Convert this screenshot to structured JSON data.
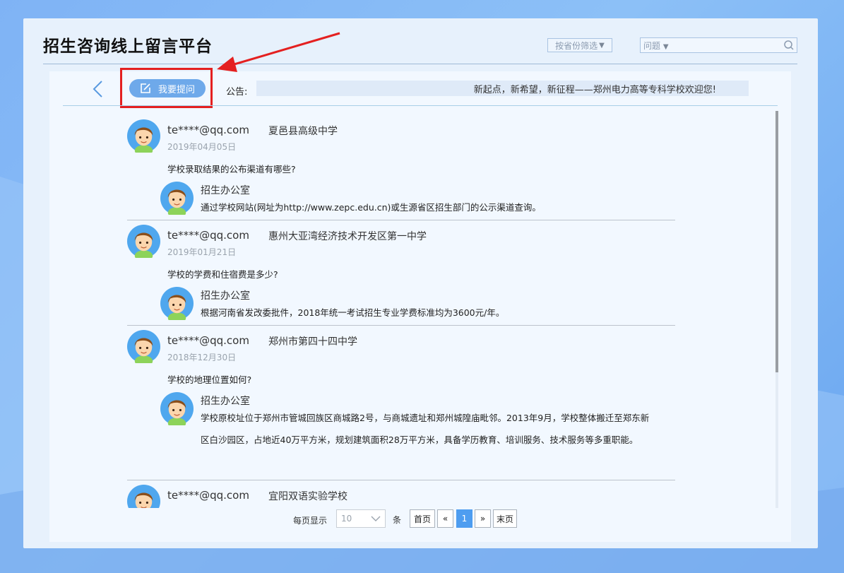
{
  "header": {
    "title": "招生咨询线上留言平台",
    "province_filter": "按省份筛选",
    "search_category": "问题"
  },
  "toolbar": {
    "ask_label": "我要提问",
    "notice_label": "公告:",
    "notice_text": "新起点，新希望，新征程——郑州电力高等专科学校欢迎您!"
  },
  "posts": [
    {
      "email": "te****@qq.com",
      "school": "夏邑县高级中学",
      "date": "2019年04月05日",
      "question": "学校录取结果的公布渠道有哪些?",
      "replier": "招生办公室",
      "answer": "通过学校网站(网址为http://www.zepc.edu.cn)或生源省区招生部门的公示渠道查询。"
    },
    {
      "email": "te****@qq.com",
      "school": "惠州大亚湾经济技术开发区第一中学",
      "date": "2019年01月21日",
      "question": "学校的学费和住宿费是多少?",
      "replier": "招生办公室",
      "answer": "根据河南省发改委批件，2018年统一考试招生专业学费标准均为3600元/年。"
    },
    {
      "email": "te****@qq.com",
      "school": "郑州市第四十四中学",
      "date": "2018年12月30日",
      "question": "学校的地理位置如何?",
      "replier": "招生办公室",
      "answer": "学校原校址位于郑州市管城回族区商城路2号，与商城遗址和郑州城隍庙毗邻。2013年9月，学校整体搬迁至郑东新区白沙园区，占地近40万平方米，规划建筑面积28万平方米，具备学历教育、培训服务、技术服务等多重职能。"
    },
    {
      "email": "te****@qq.com",
      "school": "宜阳双语实验学校"
    }
  ],
  "pagination": {
    "per_page_label": "每页显示",
    "page_size": "10",
    "unit": "条",
    "first": "首页",
    "prev": "«",
    "current": "1",
    "next": "»",
    "last": "末页"
  },
  "colors": {
    "accent": "#6ea9ea",
    "active_page": "#4e9df0",
    "annotation": "#e42020"
  }
}
